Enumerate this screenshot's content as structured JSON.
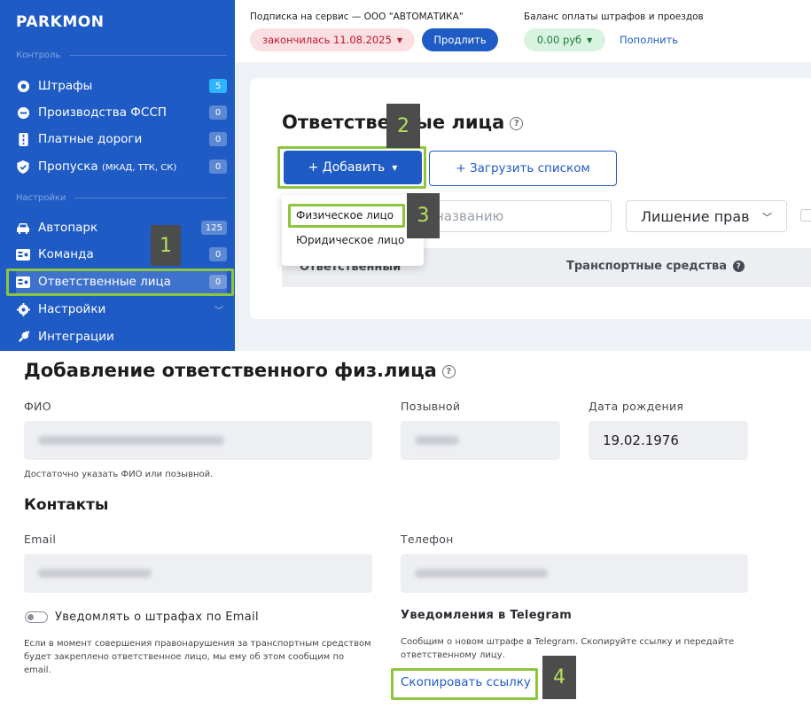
{
  "app": {
    "logo": "PARKMON"
  },
  "sidebar": {
    "section_control": "Контроль",
    "section_settings": "Настройки",
    "items": [
      {
        "label": "Штрафы",
        "badge": "5",
        "icon": "fine-icon"
      },
      {
        "label": "Производства ФССП",
        "badge": "0",
        "icon": "court-icon"
      },
      {
        "label": "Платные дороги",
        "badge": "0",
        "icon": "toll-road-icon"
      },
      {
        "label": "Пропуска",
        "label_suffix": "(МКАД, ТТК, СК)",
        "badge": "0",
        "icon": "pass-shield-icon"
      },
      {
        "label": "Автопарк",
        "badge": "125",
        "icon": "car-icon"
      },
      {
        "label": "Команда",
        "badge": "0",
        "icon": "team-card-icon"
      },
      {
        "label": "Ответственные лица",
        "badge": "0",
        "icon": "id-card-icon"
      },
      {
        "label": "Настройки",
        "icon": "gear-icon"
      },
      {
        "label": "Интеграции",
        "icon": "plug-icon"
      }
    ]
  },
  "header": {
    "subscription_label": "Подписка на сервис — ООО \"АВТОМАТИКА\"",
    "subscription_status": "закончилась 11.08.2025",
    "extend_button": "Продлить",
    "balance_label": "Баланс оплаты штрафов и проездов",
    "balance_value": "0.00 руб",
    "topup_link": "Пополнить"
  },
  "page": {
    "title": "Ответственные лица",
    "add_button": "+ Добавить",
    "upload_button": "+ Загрузить списком",
    "search_placeholder": "названию",
    "filter_value": "Лишение прав",
    "columns": [
      "Ответственный",
      "Транспортные средства"
    ]
  },
  "add_menu": {
    "items": [
      "Физическое лицо",
      "Юридическое лицо"
    ]
  },
  "steps": [
    "1",
    "2",
    "3",
    "4"
  ],
  "form": {
    "title": "Добавление ответственного физ.лица",
    "fio_label": "ФИО",
    "callsign_label": "Позывной",
    "birth_label": "Дата рождения",
    "birth_value": "19.02.1976",
    "fio_hint": "Достаточно указать ФИО или позывной.",
    "contacts_title": "Контакты",
    "email_label": "Email",
    "phone_label": "Телефон",
    "email_notify_label": "Уведомлять о штрафах по Email",
    "email_notify_note": "Если в момент совершения правонарушения за транспортным средством будет закреплено ответственное лицо, мы ему об этом сообщим по email.",
    "telegram_title": "Уведомления в Telegram",
    "telegram_note": "Сообщим о новом штрафе в Telegram. Скопируйте ссылку и передайте ответственному лицу.",
    "copy_link": "Скопировать ссылку"
  },
  "colors": {
    "brand": "#1f5bc4",
    "highlight": "#8cc63f",
    "step_text": "#b4e05a"
  }
}
